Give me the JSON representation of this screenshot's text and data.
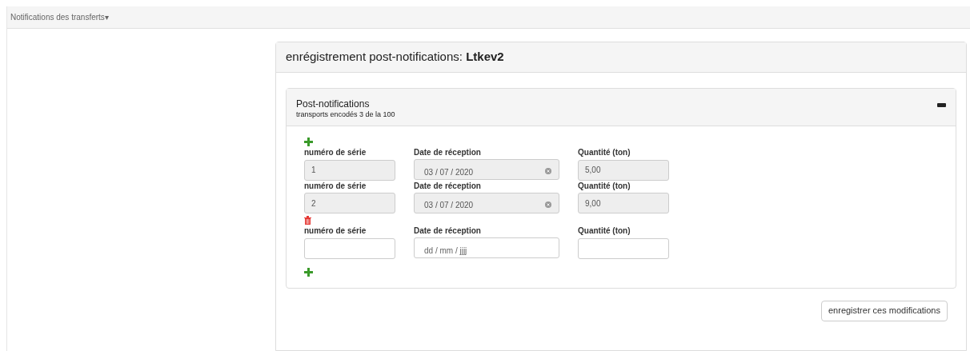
{
  "navbar": {
    "menu": "Notifications des transferts",
    "caret": "▾"
  },
  "panel": {
    "title": "enrégistrement post-notifications: **Ltkev2**",
    "section": {
      "title": "Post-notifications",
      "subtitle": "transports encodés 3 de la 100",
      "expanded": true,
      "rows": [
        {
          "removable": false,
          "fields": [
            {
              "kind": "text",
              "label": "numéro de série",
              "value": "1",
              "disabled": true
            },
            {
              "kind": "date",
              "label": "Date de réception",
              "value": "03 / 07 / 2020",
              "disabled": true
            },
            {
              "kind": "text",
              "label": "Quantité (ton)",
              "value": "5,00",
              "disabled": true
            }
          ]
        },
        {
          "removable": false,
          "fields": [
            {
              "kind": "text",
              "label": "numéro de série",
              "value": "2",
              "disabled": true
            },
            {
              "kind": "date",
              "label": "Date de réception",
              "value": "03 / 07 / 2020",
              "disabled": true
            },
            {
              "kind": "text",
              "label": "Quantité (ton)",
              "value": "9,00",
              "disabled": true
            }
          ]
        },
        {
          "removable": true,
          "fields": [
            {
              "kind": "text",
              "label": "numéro de série",
              "disabled": false
            },
            {
              "kind": "date",
              "label": "Date de réception",
              "placeholder": "dd / mm / jjjj",
              "disabled": false
            },
            {
              "kind": "text",
              "label": "Quantité (ton)",
              "disabled": false
            }
          ]
        }
      ]
    },
    "save_button": "enregistrer ces modifications"
  }
}
